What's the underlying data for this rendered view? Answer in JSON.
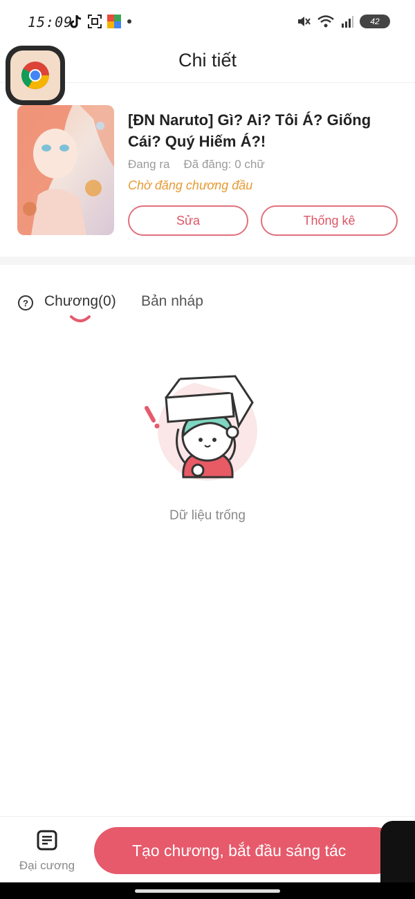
{
  "status": {
    "time": "15:09",
    "battery": "42"
  },
  "header": {
    "title": "Chi tiết"
  },
  "book": {
    "title": "[ĐN Naruto] Gì? Ai? Tôi Á? Giống Cái? Quý Hiếm Á?!",
    "status": "Đang ra",
    "words": "Đã đăng: 0 chữ",
    "state": "Chờ đăng chương đầu",
    "edit_label": "Sửa",
    "stats_label": "Thống kê"
  },
  "tabs": {
    "chapters": "Chương(0)",
    "drafts": "Bản nháp"
  },
  "empty": {
    "text": "Dữ liệu trống"
  },
  "bottom": {
    "outline_label": "Đại cương",
    "create_label": "Tạo chương, bắt đầu sáng tác"
  },
  "colors": {
    "accent": "#e65a6b",
    "state_orange": "#e69a33"
  },
  "icons": [
    "tiktok-icon",
    "screenshot-icon",
    "app-icon",
    "mute-icon",
    "wifi-icon",
    "signal-icon",
    "chrome-icon",
    "help-icon",
    "outline-icon"
  ]
}
